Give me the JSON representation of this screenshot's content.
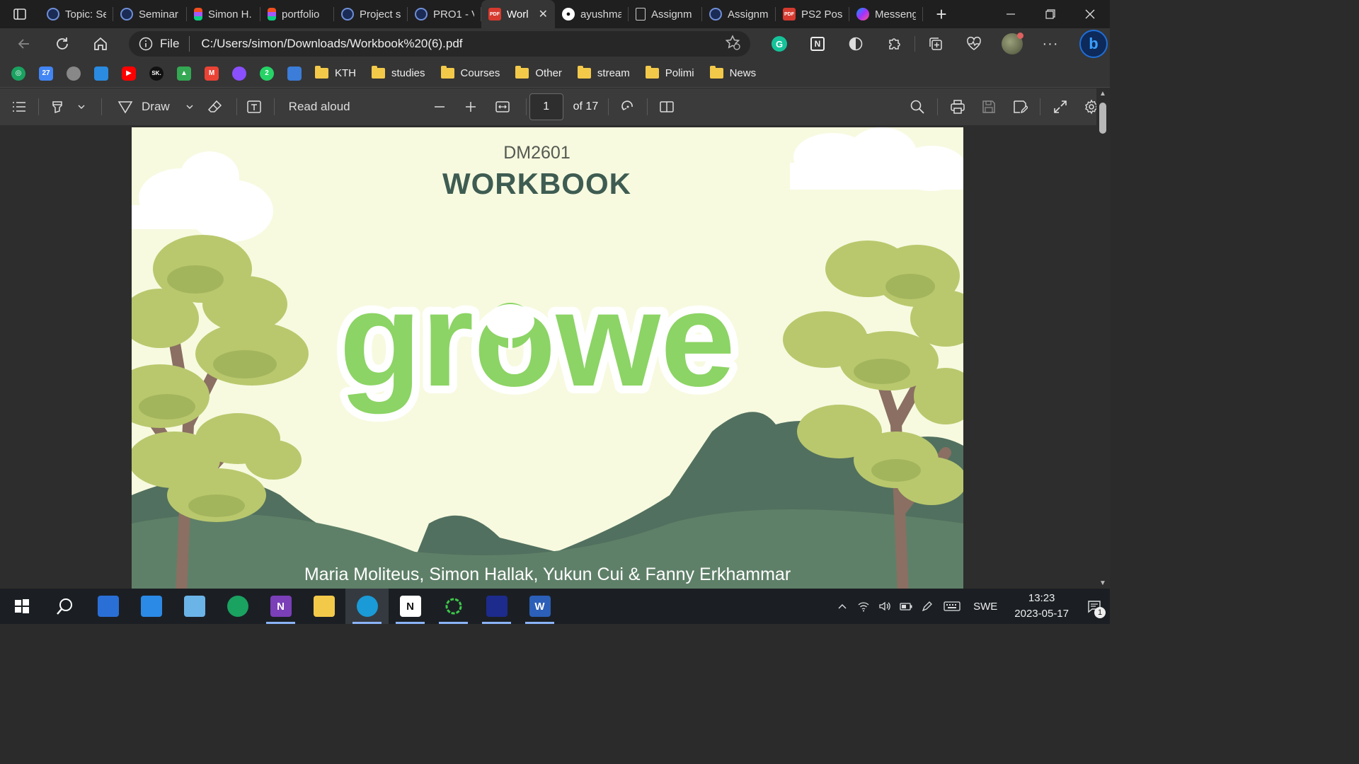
{
  "browser": {
    "tabs": [
      {
        "label": "Topic: Se",
        "icon": "globe-icon",
        "active": false
      },
      {
        "label": "Seminar",
        "icon": "globe-icon",
        "active": false
      },
      {
        "label": "Simon H.",
        "icon": "figma-icon",
        "active": false
      },
      {
        "label": "portfolio",
        "icon": "figma-icon",
        "active": false
      },
      {
        "label": "Project s",
        "icon": "globe-icon",
        "active": false
      },
      {
        "label": "PRO1 - V",
        "icon": "globe-icon",
        "active": false
      },
      {
        "label": "Worl",
        "icon": "pdf-icon",
        "active": true
      },
      {
        "label": "ayushma",
        "icon": "github-icon",
        "active": false
      },
      {
        "label": "Assignm",
        "icon": "document-icon",
        "active": false
      },
      {
        "label": "Assignm",
        "icon": "globe-icon",
        "active": false
      },
      {
        "label": "PS2 Post",
        "icon": "pdf-icon",
        "active": false
      },
      {
        "label": "Messeng",
        "icon": "messenger-icon",
        "active": false
      }
    ],
    "pdf_favicon_text": "PDF",
    "github_favicon_text": "●",
    "address": {
      "scheme_label": "File",
      "url": "C:/Users/simon/Downloads/Workbook%20(6).pdf"
    },
    "extensions": [
      "grammarly-icon",
      "notion-icon",
      "extension-icon",
      "puzzle-icon",
      "collections-icon",
      "health-icon"
    ],
    "extension_glyphs": {
      "grammarly": "G",
      "notion": "N"
    },
    "bing_label": "b",
    "favorites": [
      {
        "type": "icon",
        "name": "ring-icon",
        "color": "#1aa260",
        "text": "◎"
      },
      {
        "type": "icon",
        "name": "calendar-icon",
        "color": "#4285f4",
        "text": "27"
      },
      {
        "type": "icon",
        "name": "apple-icon",
        "color": "#888888",
        "text": ""
      },
      {
        "type": "icon",
        "name": "onedrive-icon",
        "color": "#2a8be0",
        "text": ""
      },
      {
        "type": "icon",
        "name": "youtube-icon",
        "color": "#ff0000",
        "text": "▶"
      },
      {
        "type": "icon",
        "name": "sk-icon",
        "color": "#111111",
        "text": "SK."
      },
      {
        "type": "icon",
        "name": "drive-icon",
        "color": "#34a853",
        "text": "▲"
      },
      {
        "type": "icon",
        "name": "gmail-icon",
        "color": "#ea4335",
        "text": "M"
      },
      {
        "type": "icon",
        "name": "messenger-icon",
        "color": "#8a4fff",
        "text": ""
      },
      {
        "type": "icon",
        "name": "whatsapp-icon",
        "color": "#25d366",
        "text": "2"
      },
      {
        "type": "icon",
        "name": "graduation-icon",
        "color": "#3b7dd8",
        "text": ""
      },
      {
        "type": "folder",
        "label": "KTH"
      },
      {
        "type": "folder",
        "label": "studies"
      },
      {
        "type": "folder",
        "label": "Courses"
      },
      {
        "type": "folder",
        "label": "Other"
      },
      {
        "type": "folder",
        "label": "stream"
      },
      {
        "type": "folder",
        "label": "Polimi"
      },
      {
        "type": "folder",
        "label": "News"
      }
    ]
  },
  "pdf_toolbar": {
    "draw_label": "Draw",
    "read_aloud_label": "Read aloud",
    "page_current": "1",
    "page_total": "of 17"
  },
  "document": {
    "course_code": "DM2601",
    "title": "WORKBOOK",
    "logo_text": "growe",
    "authors": "Maria Moliteus, Simon Hallak, Yukun Cui & Fanny Erkhammar",
    "colors": {
      "background": "#f7fadf",
      "logo_green": "#8cd465",
      "title": "#3e5c52",
      "hill": "#52705f",
      "tree": "#b9c86d"
    }
  },
  "taskbar": {
    "apps": [
      {
        "name": "start-icon",
        "running": false,
        "active": false
      },
      {
        "name": "search-icon",
        "running": false,
        "active": false
      },
      {
        "name": "app-manager-icon",
        "running": false,
        "active": false
      },
      {
        "name": "mail-icon",
        "running": false,
        "active": false
      },
      {
        "name": "files-icon",
        "running": false,
        "active": false
      },
      {
        "name": "ring-app-icon",
        "running": false,
        "active": false
      },
      {
        "name": "onenote-icon",
        "running": true,
        "active": false
      },
      {
        "name": "file-explorer-icon",
        "running": false,
        "active": false
      },
      {
        "name": "edge-icon",
        "running": true,
        "active": true
      },
      {
        "name": "notion-icon",
        "running": true,
        "active": false
      },
      {
        "name": "green-circle-icon",
        "running": true,
        "active": false
      },
      {
        "name": "webex-icon",
        "running": true,
        "active": false
      },
      {
        "name": "word-icon",
        "running": true,
        "active": false
      }
    ],
    "app_letters": {
      "onenote": "N",
      "notion": "N",
      "word": "W"
    },
    "language": "SWE",
    "time": "13:23",
    "date": "2023-05-17",
    "notification_count": "1"
  }
}
